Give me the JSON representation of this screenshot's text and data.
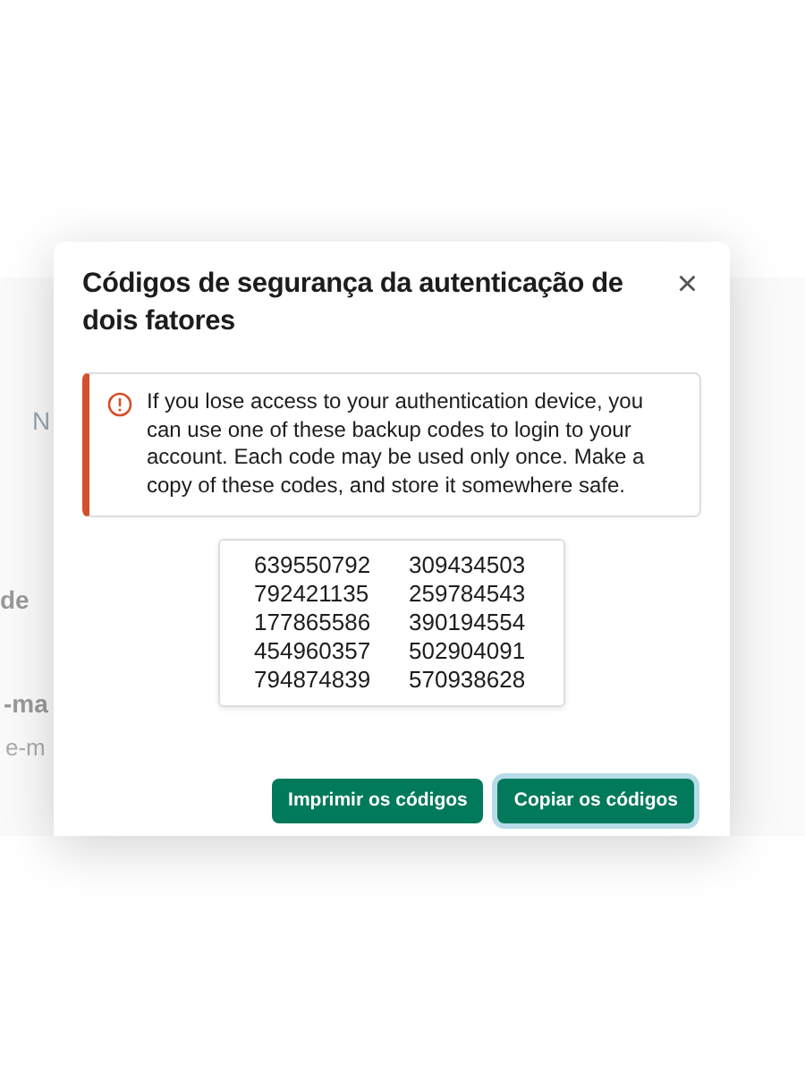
{
  "background": {
    "fragments": [
      {
        "text": "N",
        "kind": "tab"
      },
      {
        "text": "de",
        "kind": "heading"
      },
      {
        "text": "-ma",
        "kind": "heading"
      },
      {
        "text": "e-m",
        "kind": "sub"
      }
    ]
  },
  "modal": {
    "title": "Códigos de segurança da autenticação de dois fatores",
    "close": "×",
    "alert": "If you lose access to your authentication device, you can use one of these backup codes to login to your account. Each code may be used only once. Make a copy of these codes, and store it somewhere safe.",
    "codes": [
      [
        "639550792",
        "309434503"
      ],
      [
        "792421135",
        "259784543"
      ],
      [
        "177865586",
        "390194554"
      ],
      [
        "454960357",
        "502904091"
      ],
      [
        "794874839",
        "570938628"
      ]
    ],
    "buttons": [
      {
        "label": "Imprimir os códigos",
        "focused": false
      },
      {
        "label": "Copiar os códigos",
        "focused": true
      }
    ]
  }
}
